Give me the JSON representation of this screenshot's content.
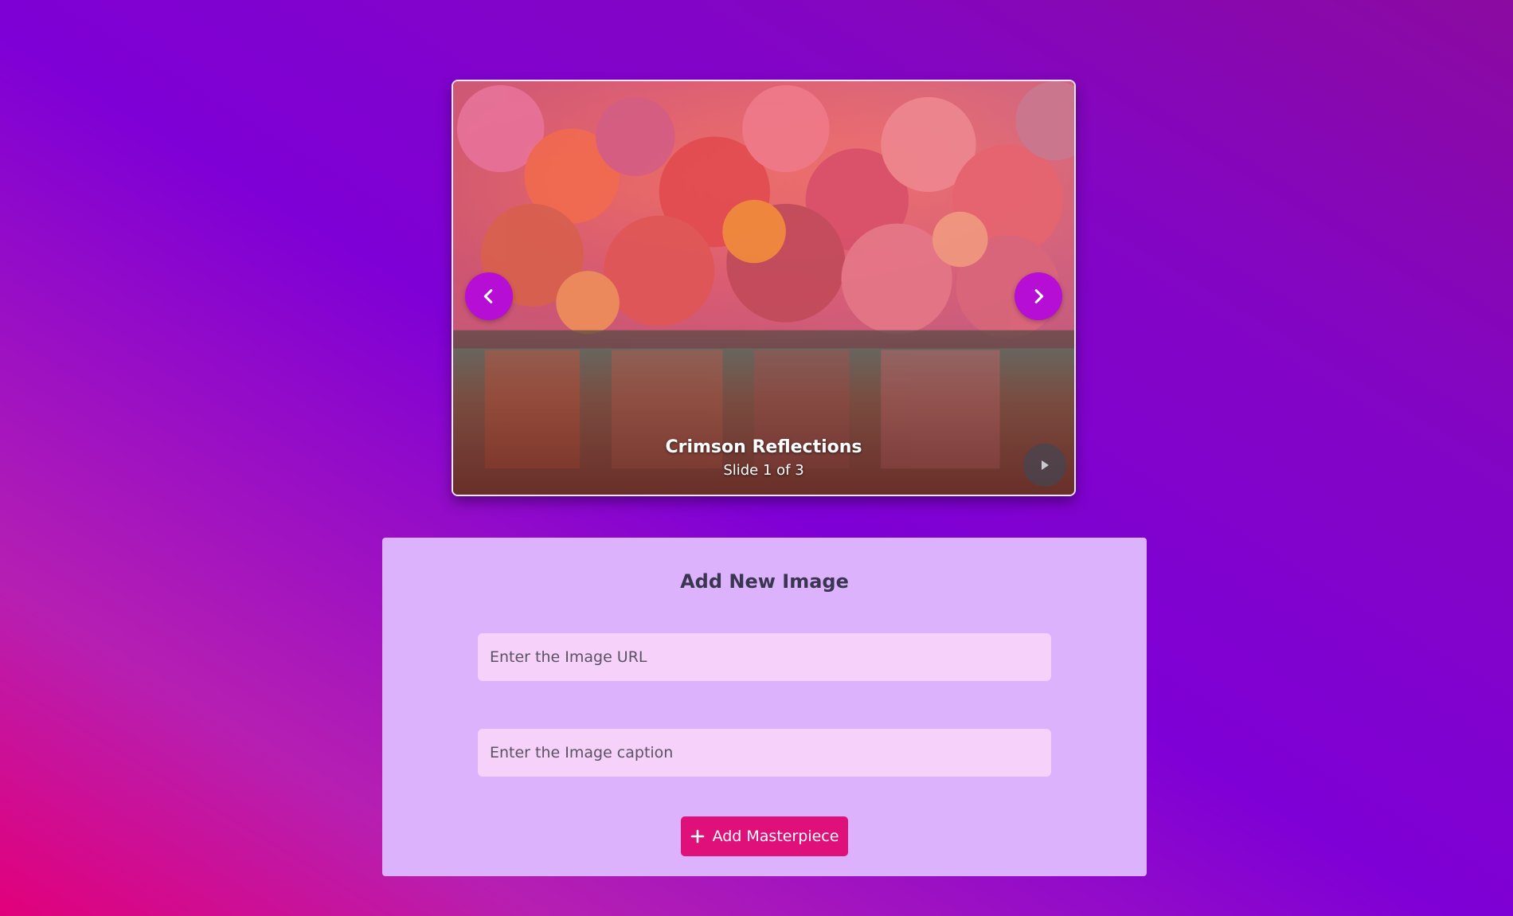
{
  "slideshow": {
    "current_title": "Crimson Reflections",
    "counter_text": "Slide 1 of 3",
    "prev_icon": "chevron-left-icon",
    "next_icon": "chevron-right-icon",
    "play_icon": "play-icon",
    "accent_color": "#b70ed6"
  },
  "form": {
    "title": "Add New Image",
    "url_input": {
      "placeholder": "Enter the Image URL",
      "value": ""
    },
    "caption_input": {
      "placeholder": "Enter the Image caption",
      "value": ""
    },
    "submit_label": "Add Masterpiece",
    "submit_icon": "plus-icon",
    "panel_color": "#dbb2fb",
    "button_color": "#e0107a"
  }
}
